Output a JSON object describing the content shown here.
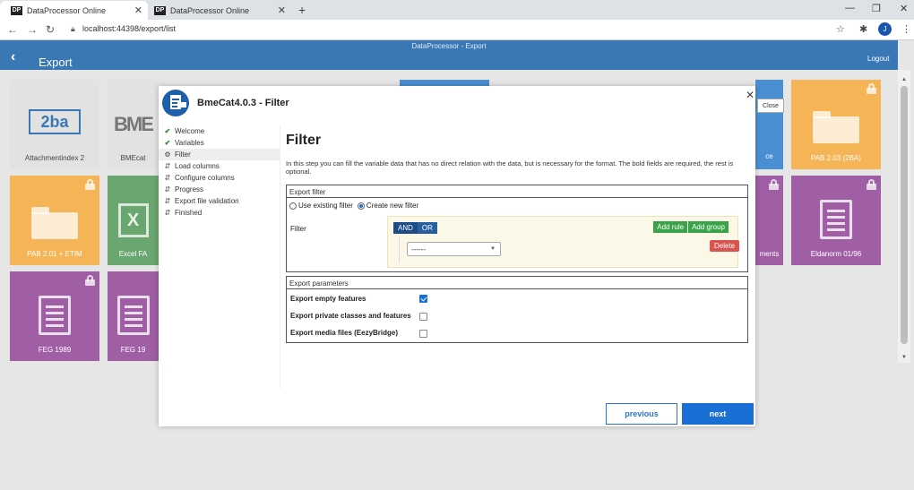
{
  "browser": {
    "tabs": [
      {
        "title": "DataProcessor Online",
        "favicon": "DP"
      },
      {
        "title": "DataProcessor Online",
        "favicon": "DP"
      }
    ],
    "new_tab": "+",
    "url": "localhost:44398/export/list",
    "profile_initial": "J",
    "icons": [
      "back-icon",
      "forward-icon",
      "reload-icon",
      "lock-icon",
      "star-icon",
      "extensions-icon",
      "menu-icon",
      "minimize-icon",
      "maximize-icon",
      "close-icon"
    ]
  },
  "app": {
    "subtitle": "DataProcessor - Export",
    "title": "Export",
    "logout": "Logout"
  },
  "tiles": [
    {
      "label": "Attachmentindex 2",
      "logo": "2ba",
      "color": "#e2e2e2",
      "locked": false
    },
    {
      "label": "BMEcat",
      "logo": "BME",
      "color": "#e2e2e2",
      "locked": false
    },
    {
      "label": "PAB 2.03 (2BA)",
      "color": "#f5b455",
      "locked": true
    },
    {
      "label": "PAB 2.01 + ETIM",
      "color": "#f5b455",
      "locked": true
    },
    {
      "label": "Excel FA",
      "color": "#6aa66f",
      "locked": false
    },
    {
      "label": "ments",
      "color": "#a05ea5",
      "locked": true
    },
    {
      "label": "Eldanorm 01/96",
      "color": "#a05ea5",
      "locked": true
    },
    {
      "label": "FEG 1989",
      "color": "#a05ea5",
      "locked": true
    },
    {
      "label": "FEG 19",
      "color": "#a05ea5",
      "locked": false
    },
    {
      "label": "ce",
      "color": "#4b8fd3",
      "locked": false
    }
  ],
  "modal": {
    "title": "BmeCat4.0.3 - Filter",
    "close_tooltip": "Close",
    "steps": [
      {
        "label": "Welcome",
        "state": "done"
      },
      {
        "label": "Variables",
        "state": "done"
      },
      {
        "label": "Filter",
        "state": "current"
      },
      {
        "label": "Load columns",
        "state": "pending"
      },
      {
        "label": "Configure columns",
        "state": "pending"
      },
      {
        "label": "Progress",
        "state": "pending"
      },
      {
        "label": "Export file validation",
        "state": "pending"
      },
      {
        "label": "Finished",
        "state": "pending"
      }
    ],
    "heading": "Filter",
    "description": "In this step you can fill the variable data that has no direct relation with the data, but is necessary for the format. The bold fields are required, the rest is optional.",
    "export_filter": {
      "title": "Export filter",
      "option_existing": "Use existing filter",
      "option_new": "Create new filter",
      "selected": "new",
      "filter_label": "Filter",
      "and_label": "AND",
      "or_label": "OR",
      "add_rule": "Add rule",
      "add_group": "Add group",
      "select_value": "------",
      "delete": "Delete"
    },
    "export_parameters": {
      "title": "Export parameters",
      "items": [
        {
          "label": "Export empty features",
          "checked": true
        },
        {
          "label": "Export private classes and features",
          "checked": false
        },
        {
          "label": "Export media files (EezyBridge)",
          "checked": false
        }
      ]
    },
    "previous": "previous",
    "next": "next"
  }
}
